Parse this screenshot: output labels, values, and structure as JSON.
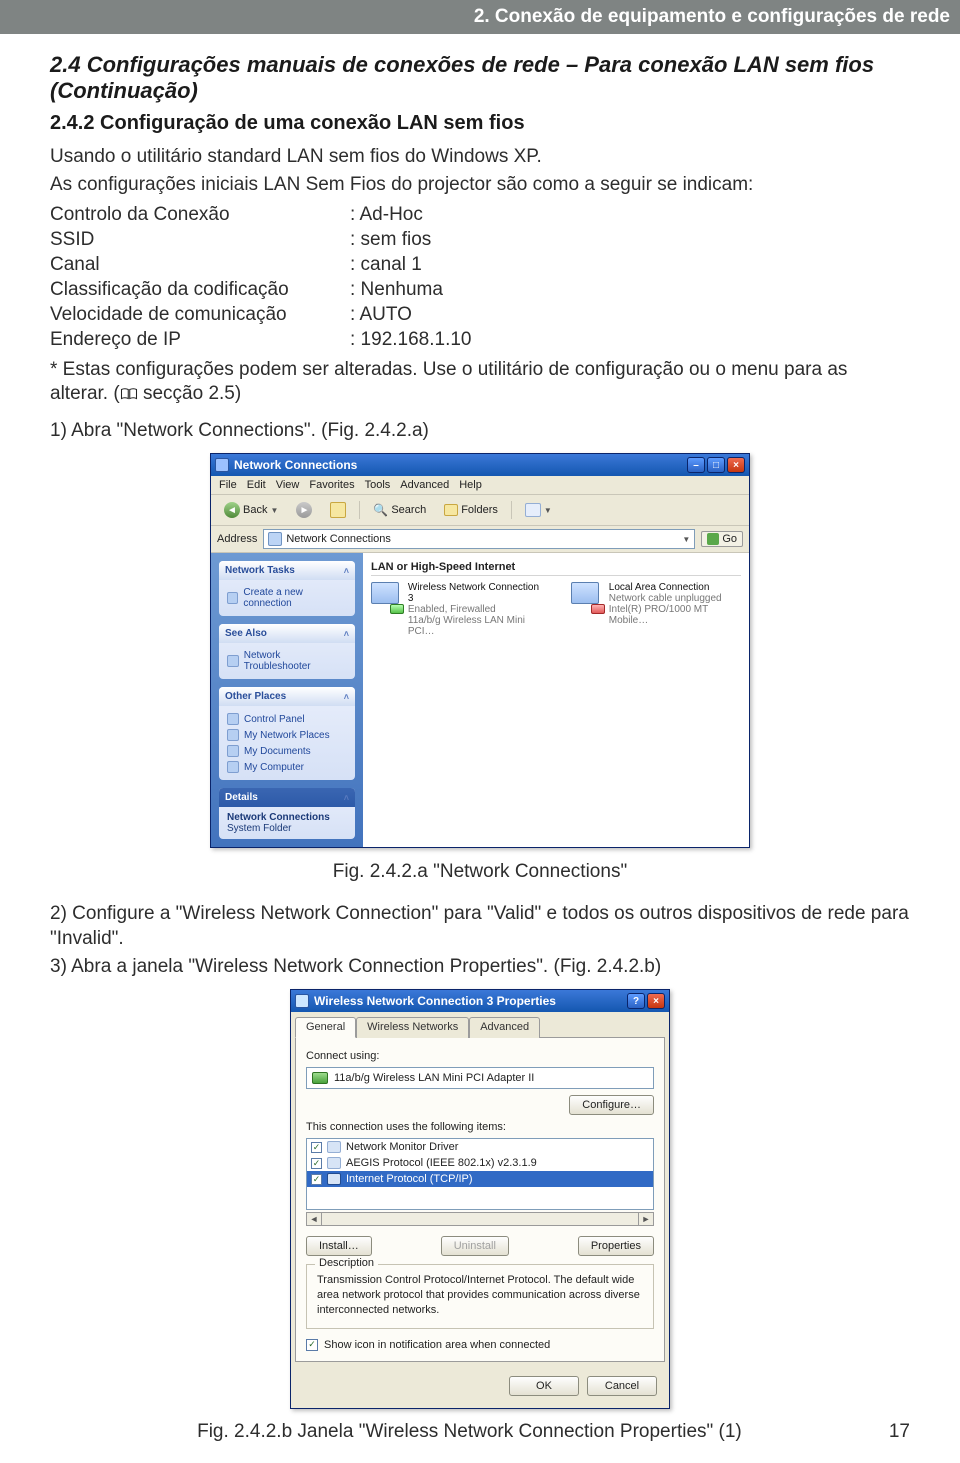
{
  "header": {
    "chapter": "2. Conexão de equipamento e configurações de rede"
  },
  "section": {
    "title": "2.4 Configurações manuais de conexões de rede – Para conexão LAN sem fios",
    "continuation": "(Continuação)",
    "subtitle": "2.4.2 Configuração de uma conexão LAN sem fios"
  },
  "intro": {
    "p1": "Usando o utilitário standard LAN sem fios do Windows XP.",
    "p2": "As configurações iniciais LAN Sem Fios do projector são como a seguir se indicam:"
  },
  "kv": [
    {
      "k": "Controlo da Conexão",
      "v": ": Ad-Hoc"
    },
    {
      "k": "SSID",
      "v": ": sem fios"
    },
    {
      "k": "Canal",
      "v": ": canal 1"
    },
    {
      "k": "Classificação da codificação",
      "v": ": Nenhuma"
    },
    {
      "k": "Velocidade de comunicação",
      "v": ": AUTO"
    },
    {
      "k": "Endereço de IP",
      "v": ": 192.168.1.10"
    }
  ],
  "note": {
    "prefix": "* Estas configurações podem ser alteradas. Use o utilitário de configuração ou o menu para as alterar. (",
    "ref": " secção 2.5)",
    "close": ""
  },
  "step1": "1) Abra \"Network Connections\". (Fig. 2.4.2.a)",
  "figA": {
    "title": "Network Connections",
    "menus": [
      "File",
      "Edit",
      "View",
      "Favorites",
      "Tools",
      "Advanced",
      "Help"
    ],
    "toolbar": {
      "back": "Back",
      "search": "Search",
      "folders": "Folders"
    },
    "address_label": "Address",
    "address_value": "Network Connections",
    "go": "Go",
    "side": {
      "tasks_h": "Network Tasks",
      "tasks_items": [
        "Create a new connection"
      ],
      "see_h": "See Also",
      "see_items": [
        "Network Troubleshooter"
      ],
      "other_h": "Other Places",
      "other_items": [
        "Control Panel",
        "My Network Places",
        "My Documents",
        "My Computer"
      ],
      "details_h": "Details",
      "details_items": [
        "Network Connections",
        "System Folder"
      ]
    },
    "main": {
      "group": "LAN or High-Speed Internet",
      "conn1_name": "Wireless Network Connection 3",
      "conn1_s1": "Enabled, Firewalled",
      "conn1_s2": "11a/b/g Wireless LAN Mini PCI…",
      "conn2_name": "Local Area Connection",
      "conn2_s1": "Network cable unplugged",
      "conn2_s2": "Intel(R) PRO/1000 MT Mobile…"
    },
    "caption": "Fig. 2.4.2.a \"Network Connections\""
  },
  "step2": "2) Configure a \"Wireless Network Connection\" para \"Valid\" e todos os outros dispositivos de rede para \"Invalid\".",
  "step3": "3) Abra a janela \"Wireless Network Connection Properties\". (Fig. 2.4.2.b)",
  "figB": {
    "title": "Wireless Network Connection 3 Properties",
    "tabs": [
      "General",
      "Wireless Networks",
      "Advanced"
    ],
    "connect_label": "Connect using:",
    "adapter": "11a/b/g Wireless LAN Mini PCI Adapter II",
    "configure": "Configure…",
    "uses": "This connection uses the following items:",
    "items": [
      {
        "checked": true,
        "sel": false,
        "text": "Network Monitor Driver"
      },
      {
        "checked": true,
        "sel": false,
        "text": "AEGIS Protocol (IEEE 802.1x) v2.3.1.9"
      },
      {
        "checked": true,
        "sel": true,
        "text": "Internet Protocol (TCP/IP)"
      }
    ],
    "install": "Install…",
    "uninstall": "Uninstall",
    "properties": "Properties",
    "desc_h": "Description",
    "desc": "Transmission Control Protocol/Internet Protocol. The default wide area network protocol that provides communication across diverse interconnected networks.",
    "show_icon": "Show icon in notification area when connected",
    "ok": "OK",
    "cancel": "Cancel"
  },
  "footer": {
    "caption": "Fig. 2.4.2.b Janela \"Wireless Network Connection Properties\" (1)",
    "page": "17"
  }
}
